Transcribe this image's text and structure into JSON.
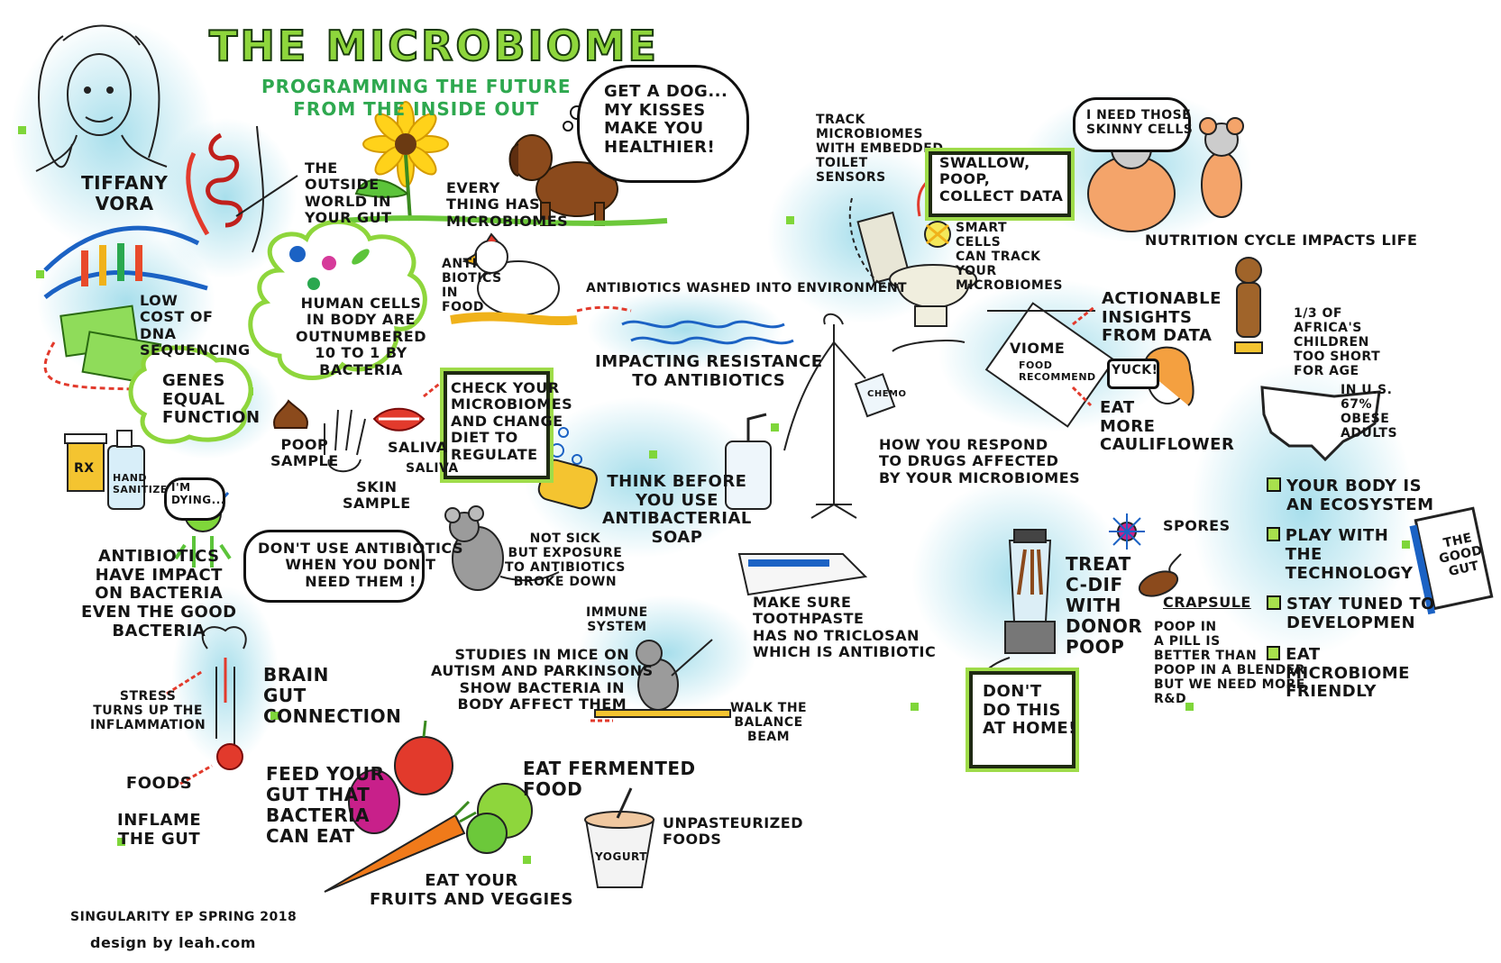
{
  "title": "THE MICROBIOME",
  "subtitle": "PROGRAMMING THE FUTURE\nFROM THE INSIDE OUT",
  "speaker": "TIFFANY\nVORA",
  "dog_bubble": "GET A DOG...\nMY KISSES\nMAKE YOU\nHEALTHIER!",
  "outside_world": "THE\nOUTSIDE\nWORLD IN\nYOUR GUT",
  "everything_microbiomes": "EVERY\nTHING HAS\nMICROBIOMES",
  "dna_sequencing": "LOW\nCOST OF\nDNA\nSEQUENCING",
  "human_cells": "HUMAN CELLS\nIN BODY ARE\nOUTNUMBERED\n10 TO 1 BY\nBACTERIA",
  "genes_function": "GENES\nEQUAL\nFUNCTION",
  "antibiotics_food": "ANTI\nBIOTICS\nIN\nFOOD",
  "washed_environment": "ANTIBIOTICS WASHED INTO ENVIRONMENT",
  "impacting_resistance": "IMPACTING RESISTANCE\nTO ANTIBIOTICS",
  "check_microbiomes": "CHECK YOUR\nMICROBIOMES\nAND CHANGE\nDIET TO\nREGULATE",
  "poop_sample": "POOP\nSAMPLE",
  "skin_sample": "SKIN\nSAMPLE",
  "saliva": "SALIVA",
  "saliva_small": "SALIVA",
  "bottle_label": "RX",
  "hand_sanitizer": "HAND\nSANITIZER",
  "im_dying": "I'M\nDYING...",
  "antibiotics_impact": "ANTIBIOTICS\nHAVE IMPACT\nON BACTERIA\nEVEN THE GOOD\nBACTERIA",
  "dont_use_antibiotics": "DON'T USE ANTIBIOTICS\nWHEN YOU DON'T\nNEED THEM !",
  "think_before_soap": "THINK BEFORE\nYOU USE\nANTIBACTERIAL\nSOAP",
  "not_sick_mouse": "NOT SICK\nBUT EXPOSURE\nTO ANTIBIOTICS\nBROKE DOWN",
  "immune_system": "IMMUNE\nSYSTEM",
  "toothpaste": "MAKE SURE\nTOOTHPASTE\nHAS NO TRICLOSAN\nWHICH IS ANTIBIOTIC",
  "studies_mice": "STUDIES IN MICE ON\nAUTISM AND PARKINSONS\nSHOW BACTERIA IN\nBODY AFFECT THEM",
  "balance_beam": "WALK THE\nBALANCE\nBEAM",
  "stress": "STRESS\nTURNS UP THE\nINFLAMMATION",
  "brain_gut": "BRAIN\nGUT\nCONNECTION",
  "foods_inflame": "FOODS\n\nINFLAME\nTHE GUT",
  "feed_gut": "FEED YOUR\nGUT THAT\nBACTERIA\nCAN EAT",
  "eat_fermented": "EAT FERMENTED\nFOOD",
  "yogurt": "YOGURT",
  "unpasteurized": "UNPASTEURIZED\nFOODS",
  "fruits_veggies": "EAT YOUR\nFRUITS AND VEGGIES",
  "footer_event": "SINGULARITY EP SPRING 2018",
  "footer_credit": "design by leah.com",
  "track_toilet": "TRACK\nMICROBIOMES\nWITH EMBEDDED\nTOILET\nSENSORS",
  "swallow_poop": "SWALLOW,\nPOOP,\nCOLLECT DATA",
  "smart_cells": "SMART\nCELLS\nCAN TRACK\nYOUR\nMICROBIOMES",
  "skinny_cells": "I NEED THOSE\nSKINNY CELLS",
  "nutrition_cycle": "NUTRITION CYCLE IMPACTS LIFE",
  "chemo": "CHEMO",
  "drugs_response": "HOW YOU RESPOND\nTO DRUGS AFFECTED\nBY YOUR MICROBIOMES",
  "viome": "VIOME",
  "food_recommend": "FOOD\nRECOMMEND",
  "actionable_insights": "ACTIONABLE\nINSIGHTS\nFROM DATA",
  "yuck": "YUCK!",
  "eat_cauliflower": "EAT\nMORE\nCAULIFLOWER",
  "africa_children": "1/3 OF\nAFRICA'S\nCHILDREN\nTOO SHORT\nFOR AGE",
  "us_obese": "IN U.S.\n67%\nOBESE\nADULTS",
  "treat_cdif": "TREAT\nC-DIF\nWITH\nDONOR\nPOOP",
  "dont_do_home": "DON'T\nDO THIS\nAT HOME!",
  "spores": "SPORES",
  "crapsule": "CRAPSULE",
  "poop_pill": "POOP IN\nA PILL IS\nBETTER THAN\nPOOP IN A BLENDER\nBUT WE NEED MORE\nR&D",
  "takeaways": [
    "YOUR BODY IS\nAN ECOSYSTEM",
    "PLAY WITH\nTHE TECHNOLOGY",
    "STAY TUNED TO\nDEVELOPMEN",
    "EAT MICROBIOME\nFRIENDLY"
  ],
  "book_title": "THE\nGOOD\nGUT",
  "colors": {
    "accent_green": "#8ed63c",
    "wash_blue": "#60c4dc",
    "ink": "#151515",
    "red": "#e0302a",
    "brown": "#8b4a1c"
  }
}
